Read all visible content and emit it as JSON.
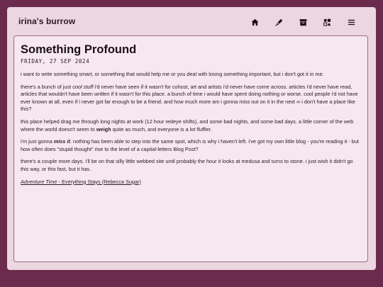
{
  "site": {
    "title": "irina's burrow"
  },
  "nav": [
    {
      "name": "home-icon",
      "label": "home"
    },
    {
      "name": "pen-icon",
      "label": "write"
    },
    {
      "name": "archive-icon",
      "label": "archive"
    },
    {
      "name": "shapes-icon",
      "label": "shapes"
    },
    {
      "name": "menu-icon",
      "label": "menu"
    }
  ],
  "post": {
    "title": "Something Profound",
    "date": "FRIDAY, 27 SEP 2024",
    "p1": "i want to write something smart, or something that would help me or you deal with losing something important, but i don't got it in me.",
    "p2": {
      "a": "there's a bunch of just ",
      "b": "cool stuff",
      "c": " i'd never have seen if it wasn't for cohost, art and artists i'd never have come across. articles i'd never have read, articles that wouldn't have been ",
      "d": "written",
      "e": " if it wasn't for this place. a bunch of time i would have spent doing nothing or worse. cool people i'd not have ever known at all, even if i never got far enough to be a friend. and how much more am i gonna miss out on it in the next ∞ i don't have a place like this?"
    },
    "p3": {
      "a": "this place helped drag me through long nights at work (12 hour redeye shifts), and some bad nights, and some bad days. a little corner of the web where the world doesn't seem to ",
      "b": "weigh",
      "c": " quite as much, and everyone is a lot fluffier."
    },
    "p4": {
      "a": "i'm just gonna ",
      "b": "miss it",
      "c": ". nothing has been able to step into the same spot, which is why i haven't left. i've got my own little blog - you're reading it - but how often does \"stupid thought\" rise to the level of a capital-letters Blog Post?"
    },
    "p5": "there's a couple more days. i'll be on that silly little webbed site until probably the hour it looks at medusa and turns to stone. i just wish it didn't go this way, or this fast, but it has.",
    "link": {
      "show": "Adventure Time",
      "rest": " - Everything Stays (Rebecca Sugar)"
    }
  },
  "colors": {
    "background": "#6b2b4c",
    "frame": "#ecd6e0",
    "card": "#f5e8ee",
    "border": "#9b6b84",
    "text": "#2a1a24"
  }
}
